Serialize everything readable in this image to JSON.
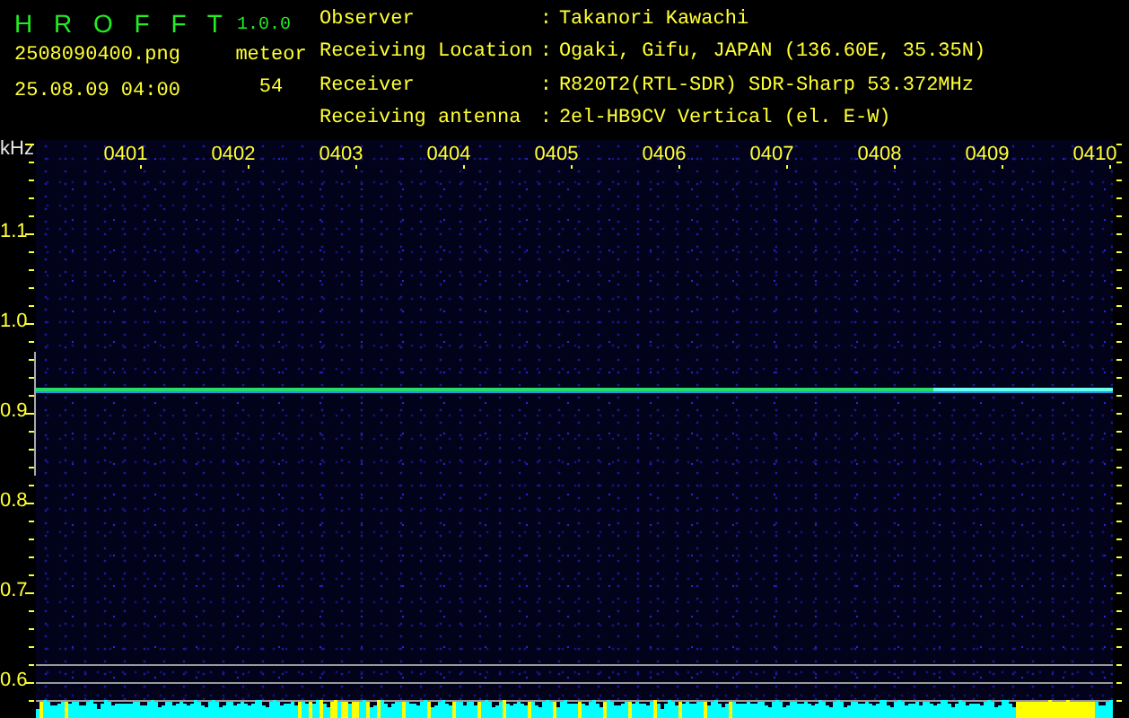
{
  "app": {
    "title": "H R O F F T",
    "version": "1.0.0",
    "filename": "2508090400.png",
    "timestamp": "25.08.09 04:00",
    "count_label": "meteor",
    "count": "54"
  },
  "info": [
    {
      "label": "Observer",
      "separator": ":",
      "value": "Takanori Kawachi"
    },
    {
      "label": "Receiving Location",
      "separator": ":",
      "value": "Ogaki, Gifu, JAPAN (136.60E, 35.35N)"
    },
    {
      "label": "Receiver",
      "separator": ":",
      "value": "R820T2(RTL-SDR) SDR-Sharp 53.372MHz"
    },
    {
      "label": "Receiving antenna",
      "separator": ":",
      "value": "2el-HB9CV Vertical (el. E-W)"
    }
  ],
  "spectrogram": {
    "unit": "kHz",
    "x_ticks": [
      "0401",
      "0402",
      "0403",
      "0404",
      "0405",
      "0406",
      "0407",
      "0408",
      "0409",
      "0410"
    ],
    "y_ticks": [
      "1.1",
      "1.0",
      "0.9",
      "0.8",
      "0.7",
      "0.6"
    ]
  }
}
